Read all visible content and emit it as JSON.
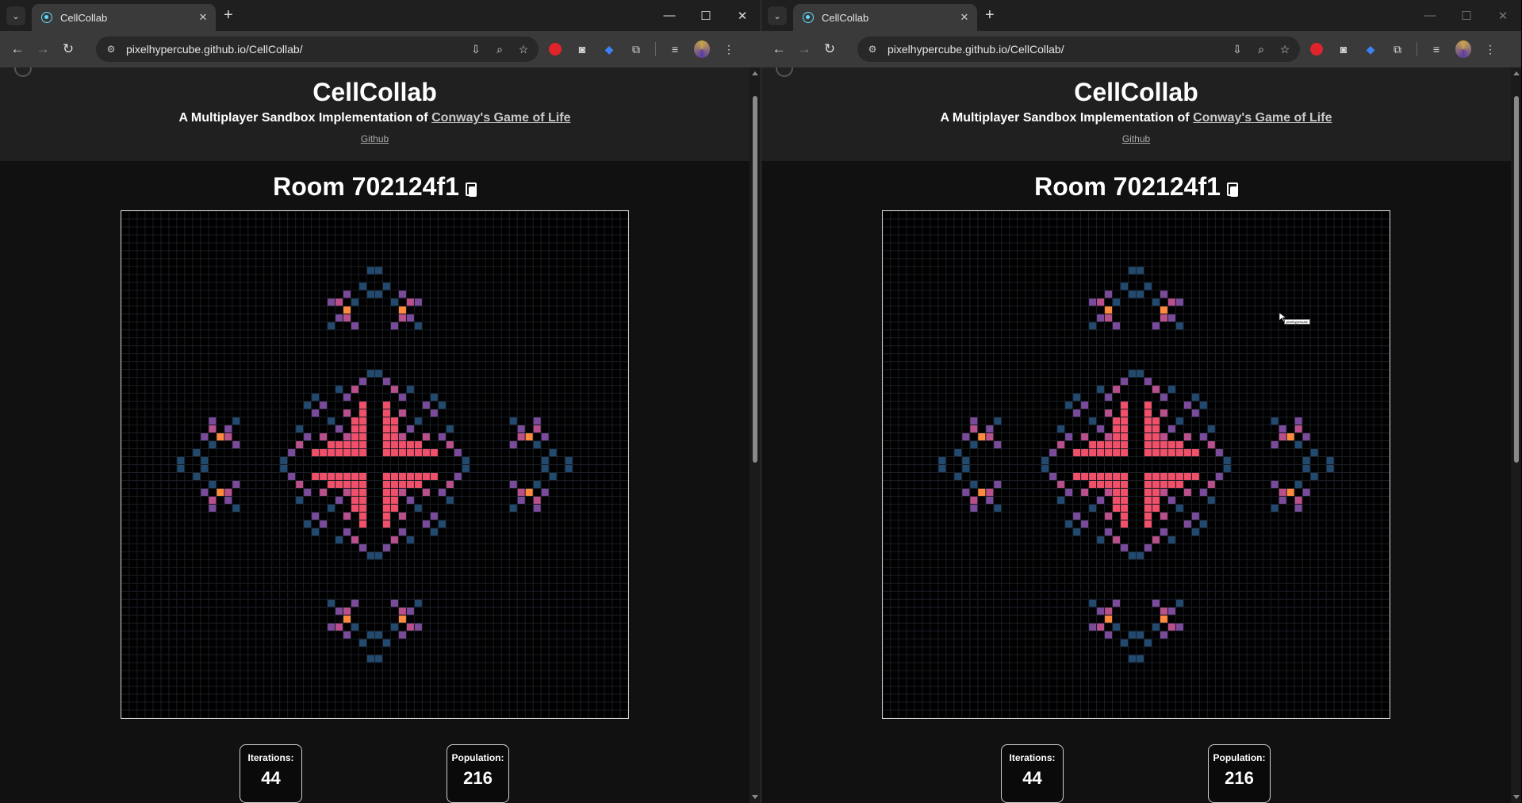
{
  "windows": [
    {
      "tab": {
        "title": "CellCollab"
      },
      "url": "pixelhypercube.github.io/CellCollab/",
      "header": {
        "title": "CellCollab",
        "subtitle_prefix": "A Multiplayer Sandbox Implementation of ",
        "subtitle_link": "Conway's Game of Life",
        "github": "Github"
      },
      "room": {
        "title": "Room 702124f1"
      },
      "stats": [
        {
          "label": "Iterations:",
          "value": "44"
        },
        {
          "label": "Population:",
          "value": "216"
        }
      ],
      "controls_dim": false
    },
    {
      "tab": {
        "title": "CellCollab"
      },
      "url": "pixelhypercube.github.io/CellCollab/",
      "header": {
        "title": "CellCollab",
        "subtitle_prefix": "A Multiplayer Sandbox Implementation of ",
        "subtitle_link": "Conway's Game of Life",
        "github": "Github"
      },
      "room": {
        "title": "Room 702124f1"
      },
      "stats": [
        {
          "label": "Iterations:",
          "value": "44"
        },
        {
          "label": "Population:",
          "value": "216"
        }
      ],
      "controls_dim": true,
      "remote_cursor": {
        "label": "pixelhypercube"
      }
    }
  ],
  "colors": {
    "page_bg": "#111111",
    "header_bg": "#202020",
    "board_bg": "#000000",
    "grid_line": "#1a1d24",
    "cell_blue": "#22496e",
    "cell_purple": "#7a4b9a",
    "cell_pink": "#b9508c",
    "cell_red": "#f0506a",
    "cell_orange": "#ff8a3d"
  },
  "icons": {
    "tab_search": "chevron-down-icon",
    "new_tab": "plus-icon",
    "back": "arrow-left-icon",
    "forward": "arrow-right-icon",
    "reload": "reload-icon",
    "copy": "copy-icon"
  }
}
